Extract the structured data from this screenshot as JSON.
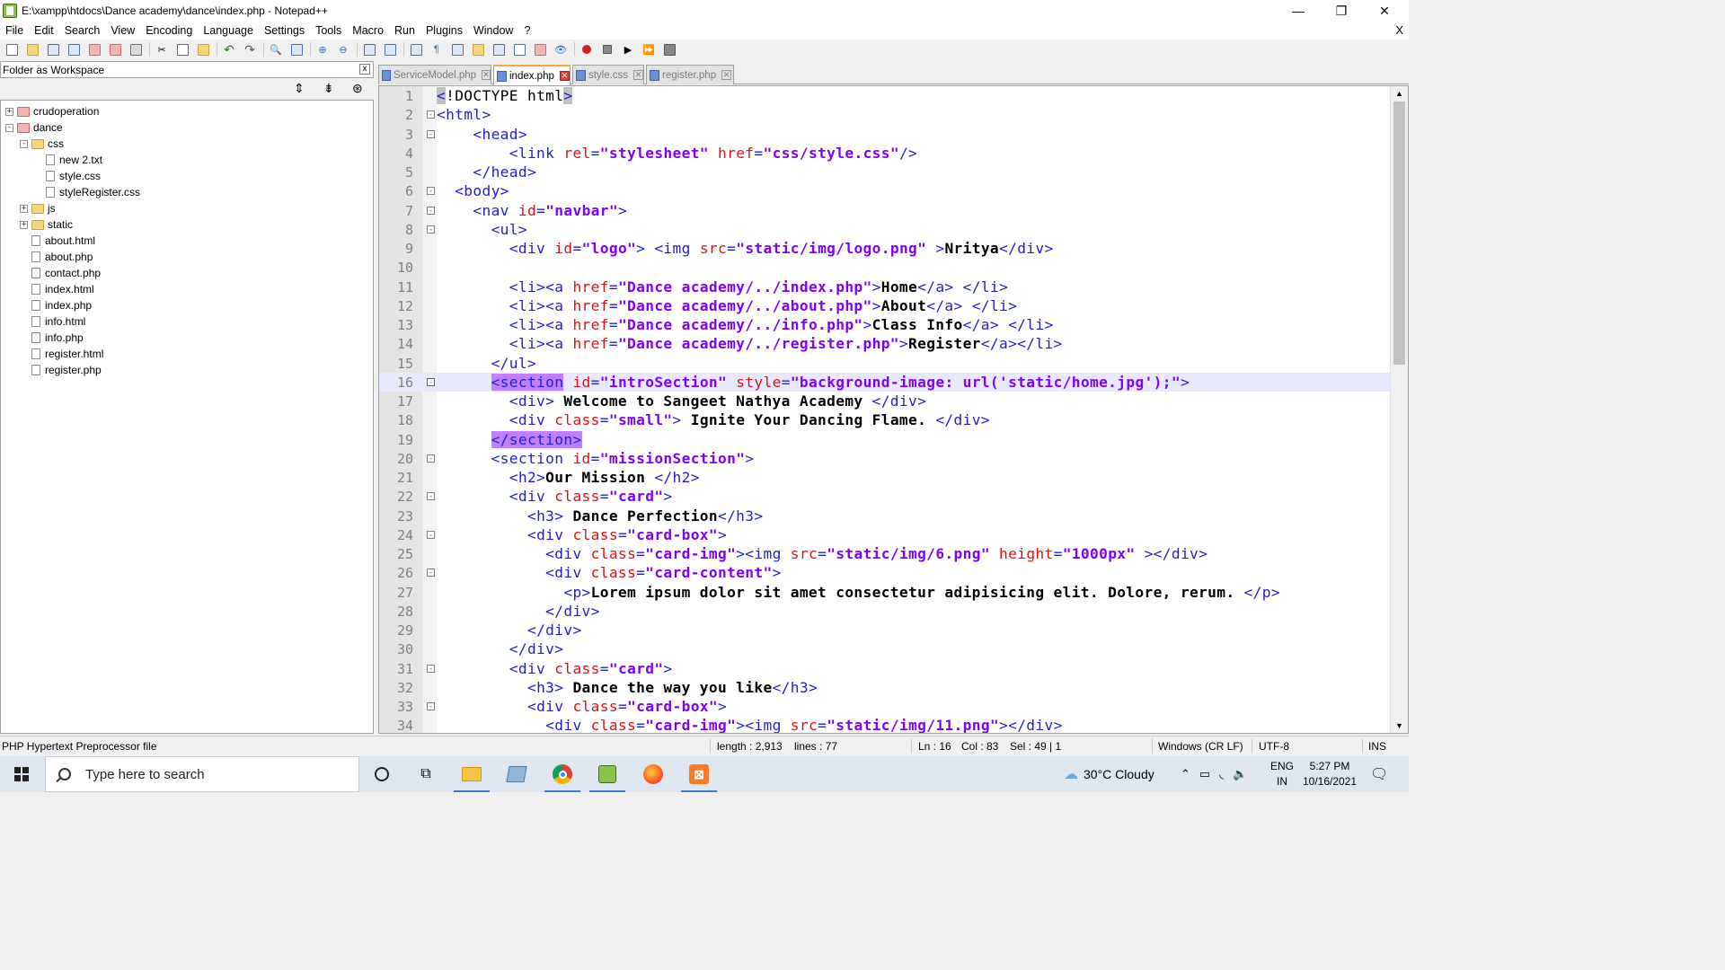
{
  "window": {
    "title": "E:\\xampp\\htdocs\\Dance academy\\dance\\index.php - Notepad++",
    "minimize": "—",
    "restore": "❐",
    "close": "✕"
  },
  "menu": {
    "items": [
      "File",
      "Edit",
      "Search",
      "View",
      "Encoding",
      "Language",
      "Settings",
      "Tools",
      "Macro",
      "Run",
      "Plugins",
      "Window",
      "?"
    ],
    "close": "X"
  },
  "workspace": {
    "title": "Folder as Workspace",
    "close": "x",
    "tree": [
      {
        "label": "crudoperation",
        "type": "root",
        "level": 0,
        "expander": "+"
      },
      {
        "label": "dance",
        "type": "root",
        "level": 0,
        "expander": "-"
      },
      {
        "label": "css",
        "type": "folder",
        "level": 1,
        "expander": "-"
      },
      {
        "label": "new 2.txt",
        "type": "file",
        "level": 2
      },
      {
        "label": "style.css",
        "type": "file",
        "level": 2
      },
      {
        "label": "styleRegister.css",
        "type": "file",
        "level": 2
      },
      {
        "label": "js",
        "type": "folder",
        "level": 1,
        "expander": "+"
      },
      {
        "label": "static",
        "type": "folder",
        "level": 1,
        "expander": "+"
      },
      {
        "label": "about.html",
        "type": "file",
        "level": 1
      },
      {
        "label": "about.php",
        "type": "file",
        "level": 1
      },
      {
        "label": "contact.php",
        "type": "file",
        "level": 1
      },
      {
        "label": "index.html",
        "type": "file",
        "level": 1
      },
      {
        "label": "index.php",
        "type": "file",
        "level": 1
      },
      {
        "label": "info.html",
        "type": "file",
        "level": 1
      },
      {
        "label": "info.php",
        "type": "file",
        "level": 1
      },
      {
        "label": "register.html",
        "type": "file",
        "level": 1
      },
      {
        "label": "register.php",
        "type": "file",
        "level": 1
      }
    ]
  },
  "tabs": [
    {
      "label": "ServiceModel.php",
      "active": false
    },
    {
      "label": "index.php",
      "active": true
    },
    {
      "label": "style.css",
      "active": false
    },
    {
      "label": "register.php",
      "active": false
    }
  ],
  "editor": {
    "current_line": 16,
    "lines": [
      {
        "n": 1,
        "fold": "",
        "tokens": [
          [
            "hl-tag",
            "<"
          ],
          [
            "txt2",
            "!DOCTYPE html"
          ],
          [
            "hl-tag",
            ">"
          ]
        ]
      },
      {
        "n": 2,
        "fold": "-",
        "tokens": [
          [
            "tag",
            "<html>"
          ]
        ]
      },
      {
        "n": 3,
        "fold": "-",
        "tokens": [
          [
            "sp",
            "    "
          ],
          [
            "tag",
            "<head>"
          ]
        ]
      },
      {
        "n": 4,
        "fold": "",
        "tokens": [
          [
            "sp",
            "        "
          ],
          [
            "tag",
            "<link "
          ],
          [
            "attr",
            "rel"
          ],
          [
            "tag",
            "="
          ],
          [
            "val",
            "\"stylesheet\""
          ],
          [
            "tag",
            " "
          ],
          [
            "attr",
            "href"
          ],
          [
            "tag",
            "="
          ],
          [
            "val",
            "\"css/style.css\""
          ],
          [
            "tag",
            "/>"
          ]
        ]
      },
      {
        "n": 5,
        "fold": "",
        "tokens": [
          [
            "sp",
            "    "
          ],
          [
            "tag",
            "</head>"
          ]
        ]
      },
      {
        "n": 6,
        "fold": "-",
        "tokens": [
          [
            "sp",
            "  "
          ],
          [
            "tag",
            "<body>"
          ]
        ]
      },
      {
        "n": 7,
        "fold": "-",
        "tokens": [
          [
            "sp",
            "    "
          ],
          [
            "tag",
            "<nav "
          ],
          [
            "attr",
            "id"
          ],
          [
            "tag",
            "="
          ],
          [
            "val",
            "\"navbar\""
          ],
          [
            "tag",
            ">"
          ]
        ]
      },
      {
        "n": 8,
        "fold": "-",
        "tokens": [
          [
            "sp",
            "      "
          ],
          [
            "tag",
            "<ul>"
          ]
        ]
      },
      {
        "n": 9,
        "fold": "",
        "tokens": [
          [
            "sp",
            "        "
          ],
          [
            "tag",
            "<div "
          ],
          [
            "attr",
            "id"
          ],
          [
            "tag",
            "="
          ],
          [
            "val",
            "\"logo\""
          ],
          [
            "tag",
            "> <img "
          ],
          [
            "attr",
            "src"
          ],
          [
            "tag",
            "="
          ],
          [
            "val",
            "\"static/img/logo.png\""
          ],
          [
            "tag",
            " >"
          ],
          [
            "txt",
            "Nritya"
          ],
          [
            "tag",
            "</div>"
          ]
        ]
      },
      {
        "n": 10,
        "fold": "",
        "tokens": []
      },
      {
        "n": 11,
        "fold": "",
        "tokens": [
          [
            "sp",
            "        "
          ],
          [
            "tag",
            "<li><a "
          ],
          [
            "attr",
            "href"
          ],
          [
            "tag",
            "="
          ],
          [
            "val",
            "\"Dance academy/../index.php\""
          ],
          [
            "tag",
            ">"
          ],
          [
            "txt",
            "Home"
          ],
          [
            "tag",
            "</a> </li>"
          ]
        ]
      },
      {
        "n": 12,
        "fold": "",
        "tokens": [
          [
            "sp",
            "        "
          ],
          [
            "tag",
            "<li><a "
          ],
          [
            "attr",
            "href"
          ],
          [
            "tag",
            "="
          ],
          [
            "val",
            "\"Dance academy/../about.php\""
          ],
          [
            "tag",
            ">"
          ],
          [
            "txt",
            "About"
          ],
          [
            "tag",
            "</a> </li>"
          ]
        ]
      },
      {
        "n": 13,
        "fold": "",
        "tokens": [
          [
            "sp",
            "        "
          ],
          [
            "tag",
            "<li><a "
          ],
          [
            "attr",
            "href"
          ],
          [
            "tag",
            "="
          ],
          [
            "val",
            "\"Dance academy/../info.php\""
          ],
          [
            "tag",
            ">"
          ],
          [
            "txt",
            "Class Info"
          ],
          [
            "tag",
            "</a> </li>"
          ]
        ]
      },
      {
        "n": 14,
        "fold": "",
        "tokens": [
          [
            "sp",
            "        "
          ],
          [
            "tag",
            "<li><a "
          ],
          [
            "attr",
            "href"
          ],
          [
            "tag",
            "="
          ],
          [
            "val",
            "\"Dance academy/../register.php\""
          ],
          [
            "tag",
            ">"
          ],
          [
            "txt",
            "Register"
          ],
          [
            "tag",
            "</a></li>"
          ]
        ]
      },
      {
        "n": 15,
        "fold": "",
        "tokens": [
          [
            "sp",
            "      "
          ],
          [
            "tag",
            "</ul>"
          ]
        ]
      },
      {
        "n": 16,
        "fold": "r",
        "tokens": [
          [
            "sp",
            "      "
          ],
          [
            "match",
            "<section"
          ],
          [
            "tag",
            " "
          ],
          [
            "attr",
            "id"
          ],
          [
            "tag",
            "="
          ],
          [
            "val",
            "\"introSection\""
          ],
          [
            "tag",
            " "
          ],
          [
            "attr",
            "style"
          ],
          [
            "tag",
            "="
          ],
          [
            "val",
            "\"background-image: url('static/home.jpg');\""
          ],
          [
            "tag",
            ">"
          ]
        ]
      },
      {
        "n": 17,
        "fold": "",
        "tokens": [
          [
            "sp",
            "        "
          ],
          [
            "tag",
            "<div> "
          ],
          [
            "txt",
            "Welcome to Sangeet Nathya Academy "
          ],
          [
            "tag",
            "</div>"
          ]
        ]
      },
      {
        "n": 18,
        "fold": "",
        "tokens": [
          [
            "sp",
            "        "
          ],
          [
            "tag",
            "<div "
          ],
          [
            "attr",
            "class"
          ],
          [
            "tag",
            "="
          ],
          [
            "val",
            "\"small\""
          ],
          [
            "tag",
            "> "
          ],
          [
            "txt",
            "Ignite Your Dancing Flame. "
          ],
          [
            "tag",
            "</div>"
          ]
        ]
      },
      {
        "n": 19,
        "fold": "",
        "tokens": [
          [
            "sp",
            "      "
          ],
          [
            "match",
            "</section>"
          ]
        ]
      },
      {
        "n": 20,
        "fold": "-",
        "tokens": [
          [
            "sp",
            "      "
          ],
          [
            "tag",
            "<section "
          ],
          [
            "attr",
            "id"
          ],
          [
            "tag",
            "="
          ],
          [
            "val",
            "\"missionSection\""
          ],
          [
            "tag",
            ">"
          ]
        ]
      },
      {
        "n": 21,
        "fold": "",
        "tokens": [
          [
            "sp",
            "        "
          ],
          [
            "tag",
            "<h2>"
          ],
          [
            "txt",
            "Our Mission "
          ],
          [
            "tag",
            "</h2>"
          ]
        ]
      },
      {
        "n": 22,
        "fold": "-",
        "tokens": [
          [
            "sp",
            "        "
          ],
          [
            "tag",
            "<div "
          ],
          [
            "attr",
            "class"
          ],
          [
            "tag",
            "="
          ],
          [
            "val",
            "\"card\""
          ],
          [
            "tag",
            ">"
          ]
        ]
      },
      {
        "n": 23,
        "fold": "",
        "tokens": [
          [
            "sp",
            "          "
          ],
          [
            "tag",
            "<h3> "
          ],
          [
            "txt",
            "Dance Perfection"
          ],
          [
            "tag",
            "</h3>"
          ]
        ]
      },
      {
        "n": 24,
        "fold": "-",
        "tokens": [
          [
            "sp",
            "          "
          ],
          [
            "tag",
            "<div "
          ],
          [
            "attr",
            "class"
          ],
          [
            "tag",
            "="
          ],
          [
            "val",
            "\"card-box\""
          ],
          [
            "tag",
            ">"
          ]
        ]
      },
      {
        "n": 25,
        "fold": "",
        "tokens": [
          [
            "sp",
            "            "
          ],
          [
            "tag",
            "<div "
          ],
          [
            "attr",
            "class"
          ],
          [
            "tag",
            "="
          ],
          [
            "val",
            "\"card-img\""
          ],
          [
            "tag",
            "><img "
          ],
          [
            "attr",
            "src"
          ],
          [
            "tag",
            "="
          ],
          [
            "val",
            "\"static/img/6.png\""
          ],
          [
            "tag",
            " "
          ],
          [
            "attr",
            "height"
          ],
          [
            "tag",
            "="
          ],
          [
            "val",
            "\"1000px\""
          ],
          [
            "tag",
            " ></div>"
          ]
        ]
      },
      {
        "n": 26,
        "fold": "-",
        "tokens": [
          [
            "sp",
            "            "
          ],
          [
            "tag",
            "<div "
          ],
          [
            "attr",
            "class"
          ],
          [
            "tag",
            "="
          ],
          [
            "val",
            "\"card-content\""
          ],
          [
            "tag",
            ">"
          ]
        ]
      },
      {
        "n": 27,
        "fold": "",
        "tokens": [
          [
            "sp",
            "              "
          ],
          [
            "tag",
            "<p>"
          ],
          [
            "txt",
            "Lorem ipsum dolor sit amet consectetur adipisicing elit. Dolore, rerum. "
          ],
          [
            "tag",
            "</p>"
          ]
        ]
      },
      {
        "n": 28,
        "fold": "",
        "tokens": [
          [
            "sp",
            "            "
          ],
          [
            "tag",
            "</div>"
          ]
        ]
      },
      {
        "n": 29,
        "fold": "",
        "tokens": [
          [
            "sp",
            "          "
          ],
          [
            "tag",
            "</div>"
          ]
        ]
      },
      {
        "n": 30,
        "fold": "",
        "tokens": [
          [
            "sp",
            "        "
          ],
          [
            "tag",
            "</div>"
          ]
        ]
      },
      {
        "n": 31,
        "fold": "-",
        "tokens": [
          [
            "sp",
            "        "
          ],
          [
            "tag",
            "<div "
          ],
          [
            "attr",
            "class"
          ],
          [
            "tag",
            "="
          ],
          [
            "val",
            "\"card\""
          ],
          [
            "tag",
            ">"
          ]
        ]
      },
      {
        "n": 32,
        "fold": "",
        "tokens": [
          [
            "sp",
            "          "
          ],
          [
            "tag",
            "<h3> "
          ],
          [
            "txt",
            "Dance the way you like"
          ],
          [
            "tag",
            "</h3>"
          ]
        ]
      },
      {
        "n": 33,
        "fold": "-",
        "tokens": [
          [
            "sp",
            "          "
          ],
          [
            "tag",
            "<div "
          ],
          [
            "attr",
            "class"
          ],
          [
            "tag",
            "="
          ],
          [
            "val",
            "\"card-box\""
          ],
          [
            "tag",
            ">"
          ]
        ]
      },
      {
        "n": 34,
        "fold": "",
        "tokens": [
          [
            "sp",
            "            "
          ],
          [
            "tag",
            "<div "
          ],
          [
            "attr",
            "class"
          ],
          [
            "tag",
            "="
          ],
          [
            "val",
            "\"card-img\""
          ],
          [
            "tag",
            "><img "
          ],
          [
            "attr",
            "src"
          ],
          [
            "tag",
            "="
          ],
          [
            "val",
            "\"static/img/11.png\""
          ],
          [
            "tag",
            "></div>"
          ]
        ]
      }
    ]
  },
  "status": {
    "file_type": "PHP Hypertext Preprocessor file",
    "length": "length : 2,913",
    "lines": "lines : 77",
    "ln": "Ln : 16",
    "col": "Col : 83",
    "sel": "Sel : 49 | 1",
    "eol": "Windows (CR LF)",
    "encoding": "UTF-8",
    "mode": "INS"
  },
  "taskbar": {
    "search_placeholder": "Type here to search",
    "weather": "30°C  Cloudy",
    "lang_top": "ENG",
    "lang_bottom": "IN",
    "time": "5:27 PM",
    "date": "10/16/2021"
  },
  "colors": {
    "tag": "#1f1fd0",
    "attr": "#e01010",
    "value": "#8000ff",
    "current_line": "#e8e8ff",
    "tab_accent": "#f7a844"
  }
}
